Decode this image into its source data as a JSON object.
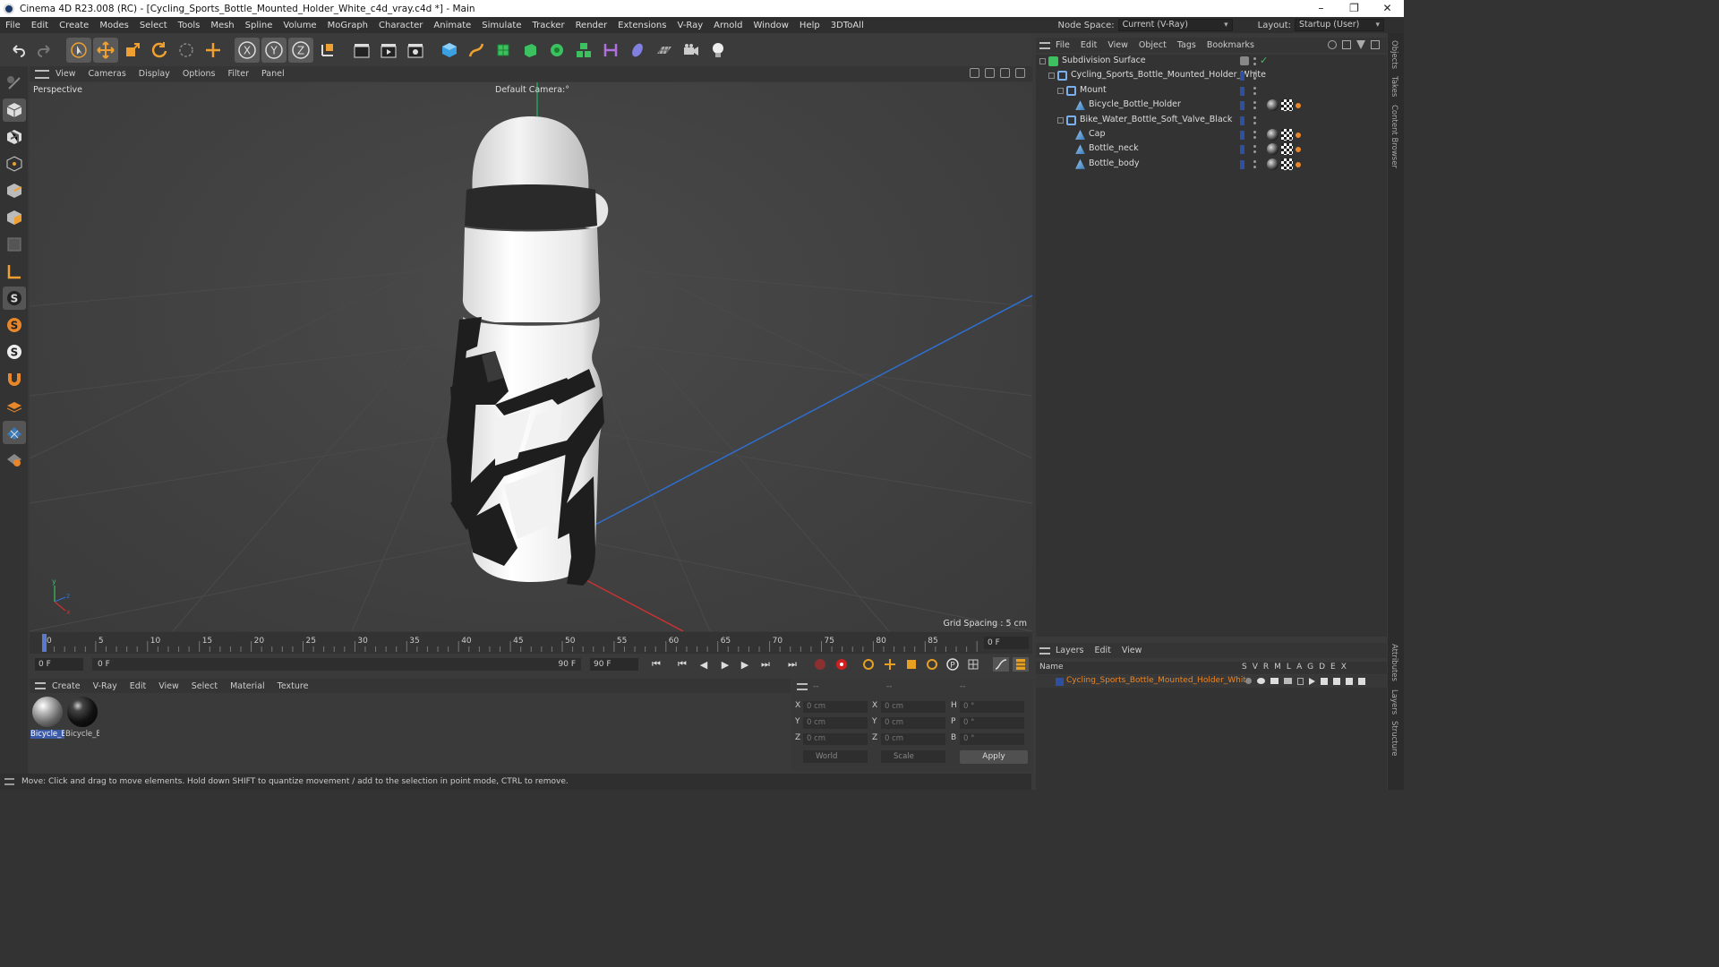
{
  "window": {
    "title": "Cinema 4D R23.008 (RC) - [Cycling_Sports_Bottle_Mounted_Holder_White_c4d_vray.c4d *] - Main",
    "minimize": "–",
    "maximize": "❐",
    "close": "✕"
  },
  "menu": {
    "items": [
      "File",
      "Edit",
      "Create",
      "Modes",
      "Select",
      "Tools",
      "Mesh",
      "Spline",
      "Volume",
      "MoGraph",
      "Character",
      "Animate",
      "Simulate",
      "Tracker",
      "Render",
      "Extensions",
      "V-Ray",
      "Arnold",
      "Window",
      "Help",
      "3DToAll"
    ],
    "node_space_label": "Node Space:",
    "node_space_value": "Current (V-Ray)",
    "layout_label": "Layout:",
    "layout_value": "Startup (User)"
  },
  "viewport": {
    "menu": [
      "View",
      "Cameras",
      "Display",
      "Options",
      "Filter",
      "Panel"
    ],
    "label": "Perspective",
    "camera": "Default Camera:°",
    "grid_spacing": "Grid Spacing : 5 cm"
  },
  "timeline": {
    "ticks": [
      "0",
      "5",
      "10",
      "15",
      "20",
      "25",
      "30",
      "35",
      "40",
      "45",
      "50",
      "55",
      "60",
      "65",
      "70",
      "75",
      "80",
      "85",
      "90"
    ],
    "current_frame": "0 F",
    "start_field": "0 F",
    "range_start": "0 F",
    "range_end": "90 F",
    "end_field": "90 F"
  },
  "materials": {
    "menu": [
      "Create",
      "V-Ray",
      "Edit",
      "View",
      "Select",
      "Material",
      "Texture"
    ],
    "items": [
      {
        "label": "Bicycle_B",
        "selected": true,
        "color": "#888888"
      },
      {
        "label": "Bicycle_E",
        "selected": false,
        "color": "#111111"
      }
    ]
  },
  "coordinates": {
    "header": [
      "--",
      "--",
      "--"
    ],
    "rows": [
      {
        "l1": "X",
        "v1": "0 cm",
        "l2": "X",
        "v2": "0 cm",
        "l3": "H",
        "v3": "0 °"
      },
      {
        "l1": "Y",
        "v1": "0 cm",
        "l2": "Y",
        "v2": "0 cm",
        "l3": "P",
        "v3": "0 °"
      },
      {
        "l1": "Z",
        "v1": "0 cm",
        "l2": "Z",
        "v2": "0 cm",
        "l3": "B",
        "v3": "0 °"
      }
    ],
    "space": "World",
    "mode": "Scale",
    "apply": "Apply"
  },
  "status": "Move: Click and drag to move elements. Hold down SHIFT to quantize movement / add to the selection in point mode, CTRL to remove.",
  "object_manager": {
    "menu": [
      "File",
      "Edit",
      "View",
      "Object",
      "Tags",
      "Bookmarks"
    ],
    "objects": [
      {
        "name": "Subdivision Surface",
        "depth": 0,
        "icon": "subdivision-icon",
        "tags": []
      },
      {
        "name": "Cycling_Sports_Bottle_Mounted_Holder_White",
        "depth": 1,
        "icon": "null-icon",
        "tags": []
      },
      {
        "name": "Mount",
        "depth": 2,
        "icon": "null-icon",
        "tags": []
      },
      {
        "name": "Bicycle_Bottle_Holder",
        "depth": 3,
        "icon": "polygon-icon",
        "tags": [
          "sph",
          "chk",
          "dot"
        ]
      },
      {
        "name": "Bike_Water_Bottle_Soft_Valve_Black",
        "depth": 2,
        "icon": "null-icon",
        "tags": []
      },
      {
        "name": "Cap",
        "depth": 3,
        "icon": "polygon-icon",
        "tags": [
          "sph",
          "chk",
          "dot"
        ]
      },
      {
        "name": "Bottle_neck",
        "depth": 3,
        "icon": "polygon-icon",
        "tags": [
          "sph",
          "chk",
          "dot"
        ]
      },
      {
        "name": "Bottle_body",
        "depth": 3,
        "icon": "polygon-icon",
        "tags": [
          "sph",
          "chk",
          "dot"
        ]
      }
    ]
  },
  "layers": {
    "menu": [
      "Layers",
      "Edit",
      "View"
    ],
    "name_col": "Name",
    "cols": "SVRMLAGDEX",
    "layer_name": "Cycling_Sports_Bottle_Mounted_Holder_White"
  },
  "side_tabs": [
    "Objects",
    "Takes",
    "Content Browser",
    "Attributes",
    "Layers",
    "Structure"
  ]
}
